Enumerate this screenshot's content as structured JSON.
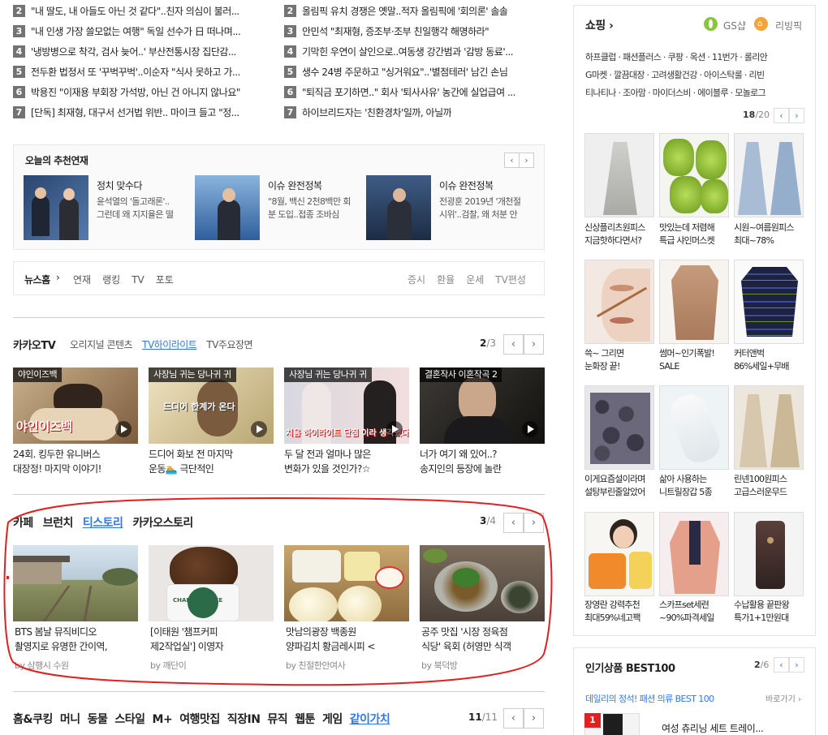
{
  "rank_left": [
    {
      "num": "2",
      "text": "\"내 딸도, 내 아들도 아닌 것 같다\"..친자 의심이 불러..."
    },
    {
      "num": "3",
      "text": "\"내 인생 가장 쓸모없는 여행\" 독일 선수가 日 떠나며..."
    },
    {
      "num": "4",
      "text": "'냉방병으로 착각, 검사 늦어..' 부산전통시장 집단감..."
    },
    {
      "num": "5",
      "text": "전두환 법정서 또 '꾸벅꾸벅'..이순자 \"식사 못하고 가..."
    },
    {
      "num": "6",
      "text": "박용진 \"이재용 부회장 가석방, 아닌 건 아니지 않나요\""
    },
    {
      "num": "7",
      "text": "[단독] 최재형, 대구서 선거법 위반.. 마이크 들고 \"정..."
    }
  ],
  "rank_right": [
    {
      "num": "2",
      "text": "올림픽 유치 경쟁은 옛말..적자 올림픽에 '회의론' 솔솔"
    },
    {
      "num": "3",
      "text": "안민석 \"최재형, 증조부·조부 친일행각 해명하라\""
    },
    {
      "num": "4",
      "text": "기막힌 우연이 살인으로..여동생 강간범과 '감방 동료'..."
    },
    {
      "num": "5",
      "text": "생수 24병 주문하고 \"싱거워요\"..'별점테러' 남긴 손님"
    },
    {
      "num": "6",
      "text": "\"퇴직금 포기하면..\" 회사 '퇴사사유' 농간에 실업급여 ..."
    },
    {
      "num": "7",
      "text": "하이브리드자는 '친환경차'일까, 아닐까"
    }
  ],
  "recommend": {
    "title": "오늘의 추천연재",
    "items": [
      {
        "title": "정치 맞수다",
        "l1": "윤석열의 '돌고래론'..",
        "l2": "그런데 왜 지지율은 떨"
      },
      {
        "title": "이슈 완전정복",
        "l1": "\"8월, 백신 2천8백만 회",
        "l2": "분 도입..접종 조바심"
      },
      {
        "title": "이슈 완전정복",
        "l1": "전광훈 2019년 '개천절",
        "l2": "시위'..검찰, 왜 처분 안"
      }
    ]
  },
  "newsnav": {
    "home": "뉴스홈",
    "items": [
      "연재",
      "랭킹",
      "TV",
      "포토"
    ],
    "right": [
      "증시",
      "환율",
      "운세",
      "TV편성"
    ]
  },
  "kakaotv": {
    "title": "카카오TV",
    "tabs": [
      "오리지널 콘텐츠",
      "TV하이라이트",
      "TV주요장면"
    ],
    "active_tab": "TV하이라이트",
    "page": "2",
    "total": "/3",
    "items": [
      {
        "tag": "야인이즈백",
        "l1": "24회. 킹두한 유니버스",
        "l2": "대장정! 마지막 이야기!",
        "overlay": "야인이즈백"
      },
      {
        "tag": "사장님 귀는 당나귀 귀",
        "l1": "드디어 화보 전 마지막",
        "l2": "운동🏊 극단적인",
        "overlay": "드디어 한계가 온다"
      },
      {
        "tag": "사장님 귀는 당나귀 귀",
        "l1": "두 달 전과 얼마나 많은",
        "l2": "변화가 있을 것인가?☆",
        "overlay": "처음 하이라이트 단점 이라 생각했다"
      },
      {
        "tag": "결혼작사 이혼작곡 2",
        "l1": "너가 여기 왜 있어..?",
        "l2": "송지인의 등장에 놀란",
        "overlay": ""
      }
    ]
  },
  "cafe": {
    "tabs": [
      "카페",
      "브런치",
      "티스토리",
      "카카오스토리"
    ],
    "active_tab": "티스토리",
    "page": "3",
    "total": "/4",
    "items": [
      {
        "l1": "BTS 봄날 뮤직비디오",
        "l2": "촬영지로 유명한 간이역,",
        "by": "by 삼행시 수원"
      },
      {
        "l1": "[이태원 '챔프커피",
        "l2": "제2작업실'] 이영자",
        "by": "by 깨단이",
        "overlay": "CHAMP COFFEE"
      },
      {
        "l1": "맛남의광장 백종원",
        "l2": "양파김치 황금레시피 <",
        "by": "by 친절한안여사"
      },
      {
        "l1": "공주 맛집 '시장 정육점",
        "l2": "식당' 육회 (허영만 식객",
        "by": "by 북덕방"
      }
    ]
  },
  "bottom_nav": {
    "items": [
      "홈&쿠킹",
      "머니",
      "동물",
      "스타일",
      "M+",
      "여행맛집",
      "직장IN",
      "뮤직",
      "웹툰",
      "게임",
      "같이가치"
    ],
    "active": "같이가치",
    "page": "11",
    "total": "/11"
  },
  "shopping": {
    "title": "쇼핑 ›",
    "gs": "GS샵",
    "living": "리빙픽",
    "links": [
      "하프클럽 · 패션플러스 · 쿠팡 · 옥션 · 11번가 · 롤리안",
      "G마켓 · 깔끔대장 · 고려생활건강 · 아이스탁룰 · 리빈",
      "티나티나 · 조아맘 · 마이더스비 · 에이블루 · 모놀로그"
    ],
    "page": "18",
    "total": "/20",
    "items": [
      {
        "l1": "신상플리츠원피스",
        "l2": "지금핫하다면서?"
      },
      {
        "l1": "맛있는데 저렴해",
        "l2": "특급 샤인머스켓"
      },
      {
        "l1": "시원~여름원피스",
        "l2": "최대~78%"
      },
      {
        "l1": "쓱~ 그리면",
        "l2": "눈화장 끝!"
      },
      {
        "l1": "썸머~인기폭발!",
        "l2": "SALE"
      },
      {
        "l1": "커터앤벅",
        "l2": "86%세일+무배"
      },
      {
        "l1": "이게요즘설이라며",
        "l2": "설탕부린줄알았어"
      },
      {
        "l1": "삶아 사용하는",
        "l2": "니트릴장갑 5종"
      },
      {
        "l1": "린넨100원피스",
        "l2": "고급스러운무드"
      },
      {
        "l1": "장영란 강력추천",
        "l2": "최대59%네고팩"
      },
      {
        "l1": "스카프set세련",
        "l2": "~90%파격세일"
      },
      {
        "l1": "수납활용 끝판왕",
        "l2": "특가1+1만원대"
      }
    ]
  },
  "best100": {
    "title": "인기상품 BEST100",
    "page": "2",
    "total": "/6",
    "subtitle": "데일리의 정석! 패션 의류 BEST 100",
    "more": "바로가기 ›",
    "first_rank": "1",
    "first_text": "여성 츄리닝 세트 트레이..."
  },
  "colors": {
    "accent_blue": "#3278e6",
    "red_circle": "#e1201f",
    "rank_badge": "#737373"
  }
}
